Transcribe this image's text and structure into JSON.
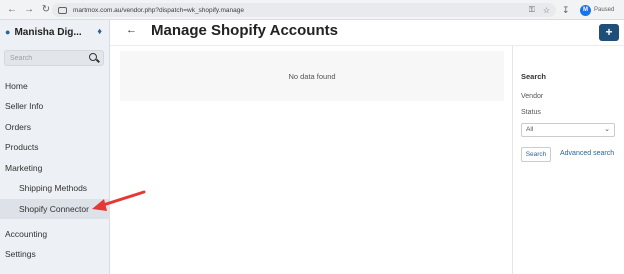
{
  "browser": {
    "url": "martmox.com.au/vendor.php?dispatch=wk_shopify.manage",
    "profile_initial": "M",
    "profile_status": "Paused"
  },
  "sidebar": {
    "user_name": "Manisha Dig...",
    "search_placeholder": "Search",
    "items": [
      {
        "label": "Home"
      },
      {
        "label": "Seller Info"
      },
      {
        "label": "Orders"
      },
      {
        "label": "Products"
      },
      {
        "label": "Marketing"
      },
      {
        "label": "Shipping Methods"
      },
      {
        "label": "Shopify Connector"
      },
      {
        "label": "Accounting"
      },
      {
        "label": "Settings"
      }
    ]
  },
  "main": {
    "title": "Manage Shopify Accounts",
    "add_label": "+",
    "empty_text": "No data found"
  },
  "search_panel": {
    "heading": "Search",
    "vendor_label": "Vendor",
    "status_label": "Status",
    "status_value": "All",
    "search_button": "Search",
    "advanced_link": "Advanced search"
  },
  "annotation": {
    "arrow_color": "#e53935"
  }
}
